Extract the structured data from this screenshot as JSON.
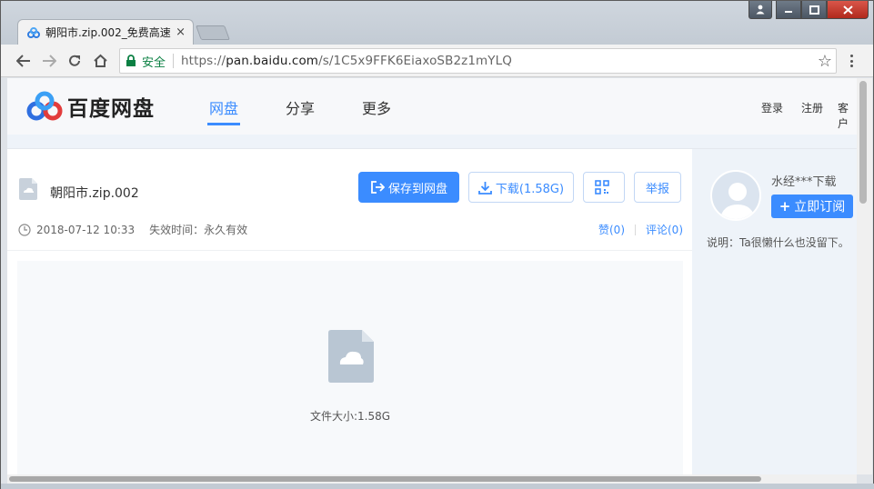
{
  "browser": {
    "tab_title": "朝阳市.zip.002_免费高速",
    "tab_close": "×",
    "secure_label": "安全",
    "url_scheme": "https://",
    "url_host": "pan.baidu.com",
    "url_path": "/s/1C5x9FFK6EiaxoSB2z1mYLQ"
  },
  "site": {
    "logo_text": "百度网盘",
    "nav": [
      {
        "label": "网盘",
        "active": true
      },
      {
        "label": "分享",
        "active": false
      },
      {
        "label": "更多",
        "active": false
      }
    ],
    "header_right": {
      "login": "登录",
      "register": "注册",
      "client": "客户"
    }
  },
  "file": {
    "name": "朝阳市.zip.002",
    "save_button": "保存到网盘",
    "download_button": "下载(1.58G)",
    "report_button": "举报",
    "date": "2018-07-12 10:33",
    "expiry": "失效时间：永久有效",
    "likes": "赞(0)",
    "comments": "评论(0)",
    "size_text": "文件大小:1.58G"
  },
  "sharer": {
    "name": "水经***下载",
    "subscribe": "立即订阅",
    "subscribe_plus": "+",
    "description": "说明：Ta很懒什么也没留下。"
  },
  "colors": {
    "accent": "#3b8cff",
    "secure": "#0b8043"
  }
}
